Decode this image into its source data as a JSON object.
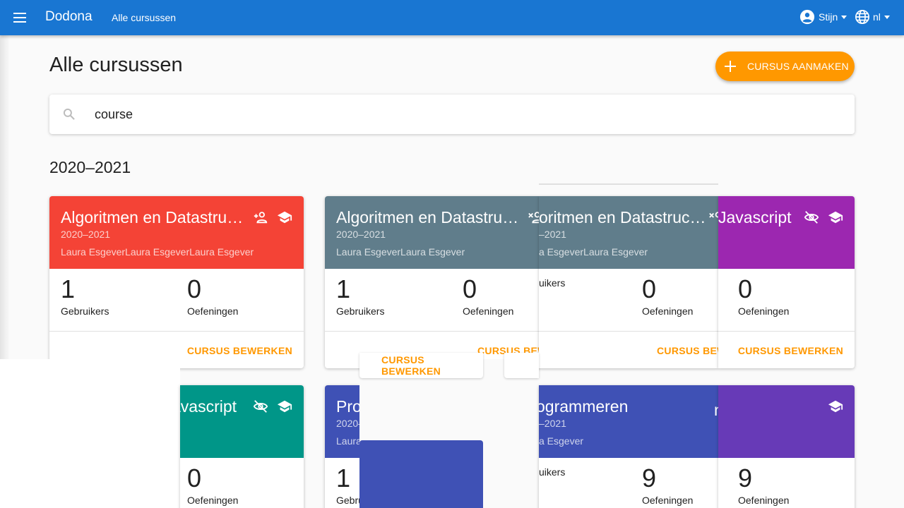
{
  "header": {
    "brand": "Dodona",
    "breadcrumb": "Alle cursussen",
    "user": "Stijn",
    "language": "nl"
  },
  "page": {
    "title": "Alle cursussen",
    "new_course_label": "CURSUS AANMAKEN"
  },
  "search": {
    "value": "course",
    "placeholder": ""
  },
  "year_heading": "2020–2021",
  "labels": {
    "users": "Gebruikers",
    "exercises": "Oefeningen",
    "edit": "CURSUS BEWERKEN",
    "edit_cut": "CURSUS BEWI",
    "edit_cut2": "CURSUS BEWE",
    "users_cut": "uikers"
  },
  "cards_row1": [
    {
      "title": "Algoritmen en Datastructuren",
      "year": "2020–2021",
      "teachers": "Laura EsgeverLaura EsgeverLaura Esgever",
      "users": "1",
      "exercises": "0",
      "color": "#f44336"
    },
    {
      "title": "Algoritmen en Datastructuren",
      "year": "2020–2021",
      "teachers": "Laura EsgeverLaura Esgever",
      "users": "1",
      "exercises": "0",
      "color": "#607d8b"
    },
    {
      "title": "oritmen en Datastruc…",
      "year": "–2021",
      "teachers": "a EsgeverLaura Esgever",
      "users": "",
      "exercises": "0",
      "color": "#607d8b"
    },
    {
      "title": "Javascript",
      "year": "",
      "teachers": "",
      "users": "",
      "exercises": "0",
      "color": "#9c27b0"
    }
  ],
  "cards_row2": [
    {
      "title": "avascript",
      "year": "",
      "teachers": "",
      "users": "",
      "exercises": "0",
      "color": "#009688"
    },
    {
      "title": "Pro",
      "year": "2020–",
      "teachers": "Laura",
      "users": "1",
      "exercises": "",
      "color": "#3f51b5"
    },
    {
      "title": "ogrammeren",
      "year": "–2021",
      "teachers": "a Esgever",
      "users": "",
      "exercises": "9",
      "color": "#3f51b5"
    },
    {
      "title": "",
      "year": "",
      "teachers": "",
      "users": "",
      "exercises": "9",
      "color": "#673ab7"
    }
  ],
  "row2_partial": {
    "users_cut": "Gebru"
  },
  "colors": {
    "appbar": "#1976d2",
    "accent": "#ff9800"
  }
}
